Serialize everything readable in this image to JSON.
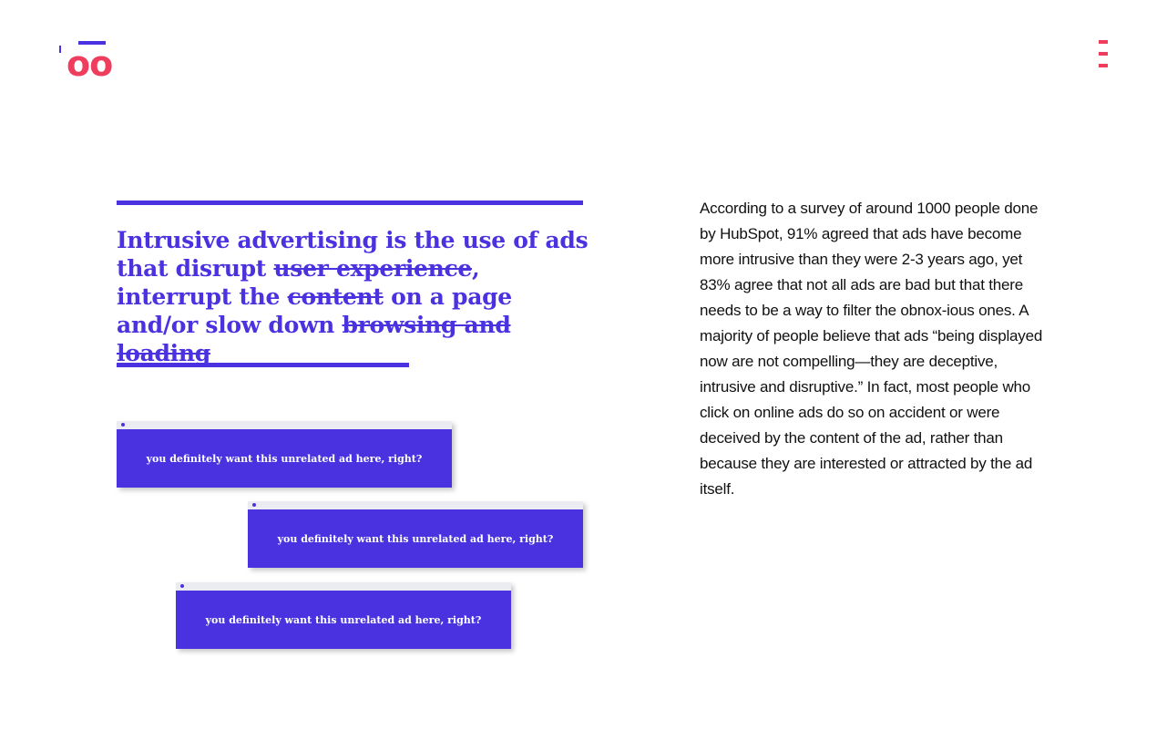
{
  "logo": {
    "text": "oo"
  },
  "menu": {
    "icon": "menu-icon"
  },
  "headline": {
    "part1": "Intrusive advertising is the use of ads that disrupt ",
    "struck1": "user experience",
    "part2": ", interrupt the ",
    "struck2": "content",
    "part3": " on a page and/or slow down ",
    "struck3": "browsing and loading"
  },
  "ads": [
    {
      "text": "you definitely want this unrelated ad here, right?"
    },
    {
      "text": "you definitely want this unrelated ad here, right?"
    },
    {
      "text": "you definitely want this unrelated ad here, right?"
    }
  ],
  "body": {
    "paragraph": "According to a survey of around 1000 people done by HubSpot, 91% agreed that ads have become more intrusive than they were 2-3 years ago, yet 83% agree that not all ads are bad but that there needs to be a way to filter the obnox-ious ones. A majority of people believe that ads “being displayed now are not compelling—they are deceptive, intrusive and disruptive.” In fact, most people who click on online ads do so on accident or were deceived by the content of the ad, rather than because they are interested or attracted by the ad itself."
  },
  "colors": {
    "accent": "#4a32e0",
    "brand": "#ef3d5e"
  }
}
